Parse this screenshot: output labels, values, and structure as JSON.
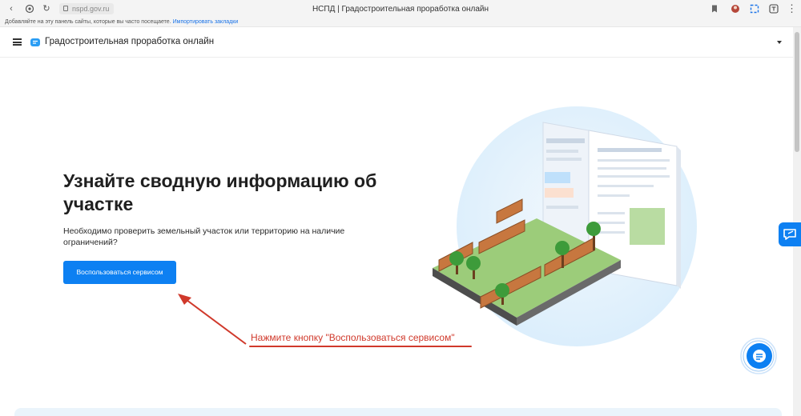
{
  "browser": {
    "url": "nspd.gov.ru",
    "tab_title": "НСПД | Градостроительная проработка онлайн",
    "bookmarks_hint": "Добавляйте на эту панель сайты, которые вы часто посещаете.",
    "bookmarks_link": "Импортировать закладки"
  },
  "header": {
    "title": "Градостроительная проработка онлайн"
  },
  "hero": {
    "title": "Узнайте сводную информацию об участке",
    "subtitle": "Необходимо проверить земельный участок или территорию на наличие ограничений?",
    "cta_label": "Воспользоваться сервисом"
  },
  "annotation": {
    "text": "Нажмите кнопку \"Воспользоваться сервисом\""
  },
  "colors": {
    "primary": "#0d80f2",
    "annotation": "#d0392b"
  }
}
